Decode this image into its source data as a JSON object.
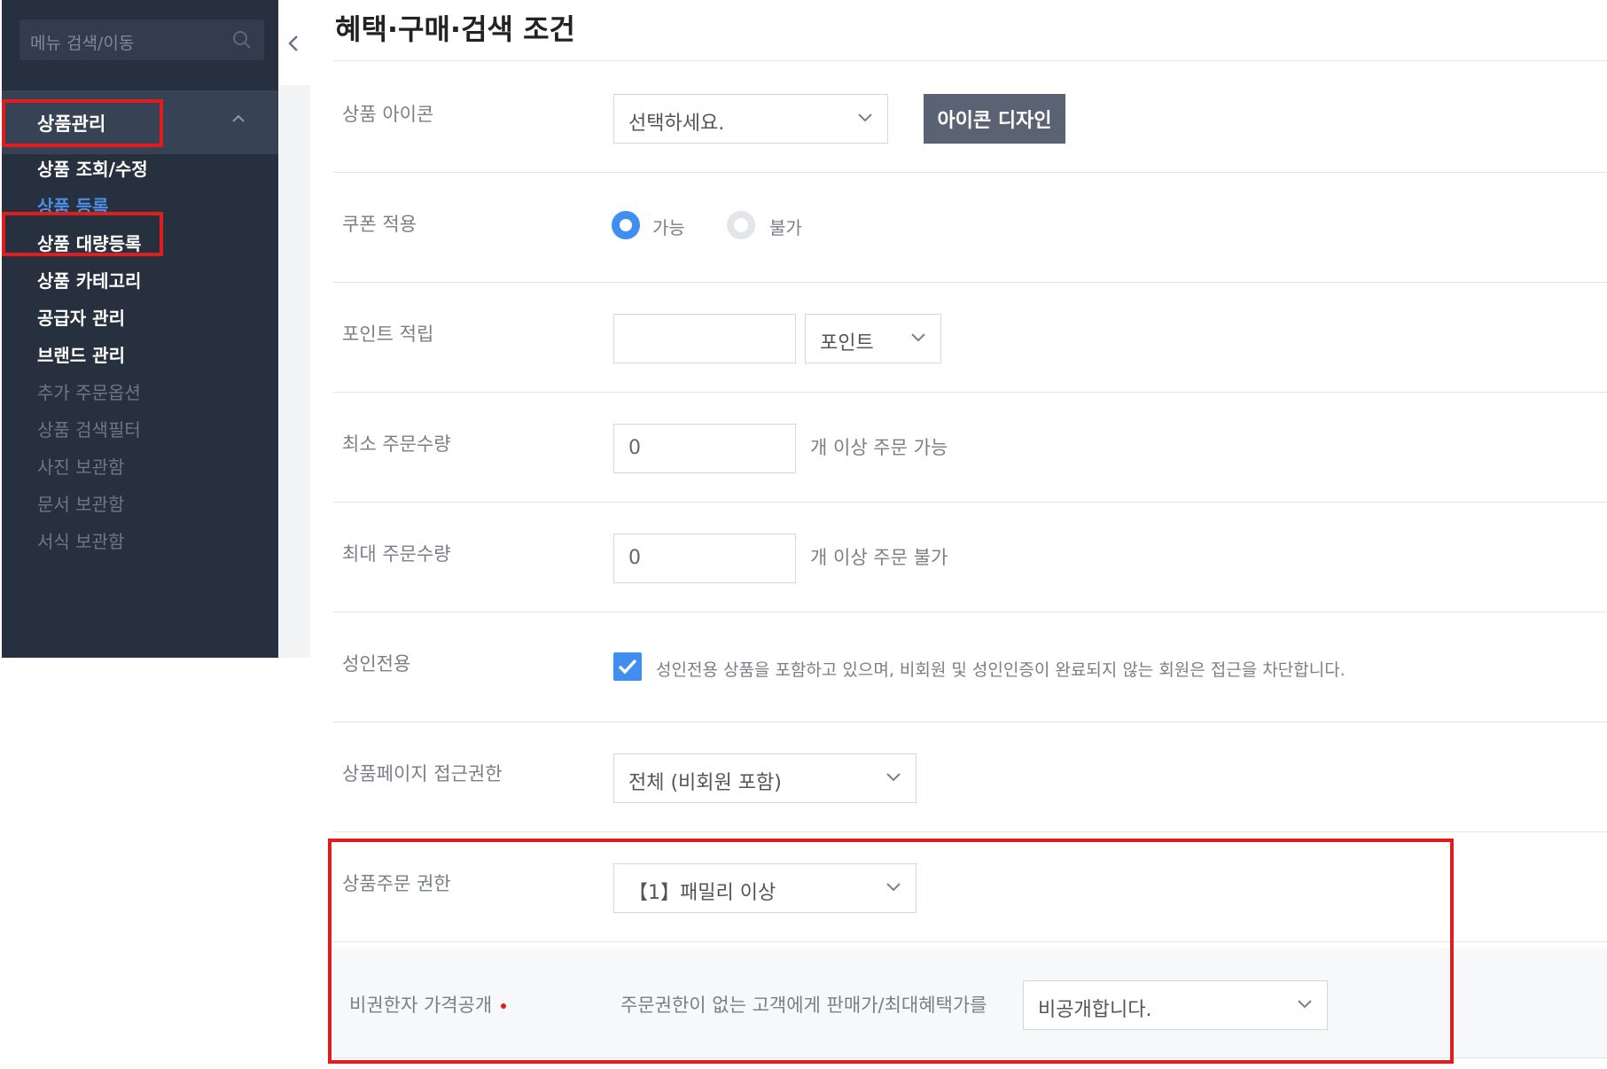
{
  "sidebar": {
    "search_placeholder": "메뉴 검색/이동",
    "group_label": "상품관리",
    "items": [
      {
        "label": "상품 조회/수정"
      },
      {
        "label": "상품 등록"
      },
      {
        "label": "상품 대량등록"
      },
      {
        "label": "상품 카테고리"
      },
      {
        "label": "공급자 관리"
      },
      {
        "label": "브랜드 관리"
      },
      {
        "label": "추가 주문옵션"
      },
      {
        "label": "상품 검색필터"
      },
      {
        "label": "사진 보관함"
      },
      {
        "label": "문서 보관함"
      },
      {
        "label": "서식 보관함"
      }
    ]
  },
  "main": {
    "title": "혜택·구매·검색 조건",
    "icon_row": {
      "label": "상품 아이콘",
      "select_value": "선택하세요.",
      "button_label": "아이콘 디자인"
    },
    "coupon_row": {
      "label": "쿠폰 적용",
      "option_on": "가능",
      "option_off": "불가"
    },
    "points_row": {
      "label": "포인트 적립",
      "input_value": "",
      "unit_value": "포인트"
    },
    "min_row": {
      "label": "최소 주문수량",
      "input_value": "0",
      "suffix": "개 이상 주문 가능"
    },
    "max_row": {
      "label": "최대 주문수량",
      "input_value": "0",
      "suffix": "개 이상 주문 불가"
    },
    "adult_row": {
      "label": "성인전용",
      "description": "성인전용 상품을 포함하고 있으며, 비회원 및 성인인증이 완료되지 않는 회원은 접근을 차단합니다."
    },
    "access_row": {
      "label": "상품페이지 접근권한",
      "select_value": "전체 (비회원 포함)"
    },
    "order_row": {
      "label": "상품주문 권한",
      "select_value": "【1】패밀리 이상"
    },
    "price_row": {
      "label": "비권한자 가격공개",
      "description": "주문권한이 없는 고객에게 판매가/최대혜택가를",
      "select_value": "비공개합니다."
    }
  },
  "colors": {
    "accent": "#3f8ef0",
    "highlight": "#e01c1c",
    "sidebar_bg": "#27303f"
  }
}
